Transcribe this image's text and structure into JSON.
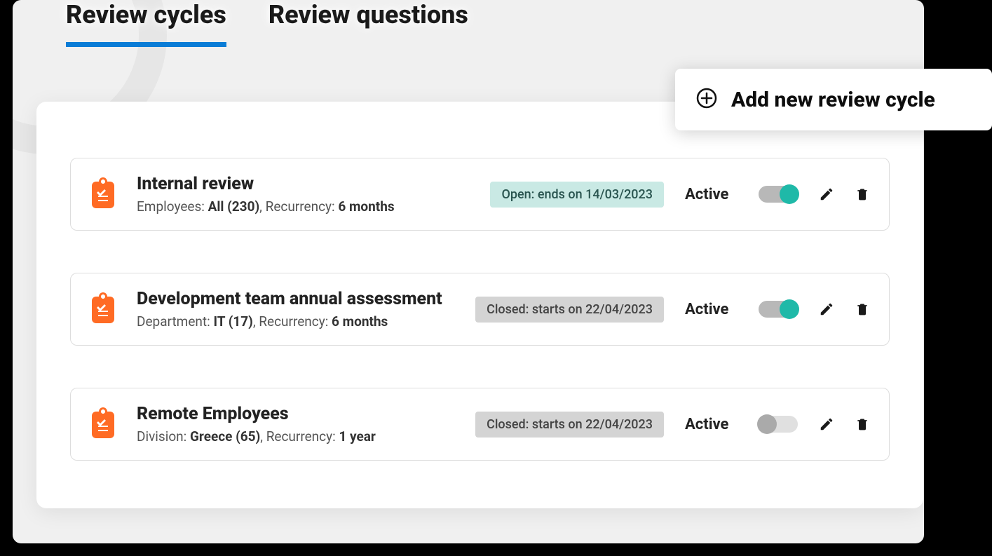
{
  "tabs": {
    "active": "Review cycles",
    "inactive": "Review questions"
  },
  "addButton": {
    "label": "Add new review cycle"
  },
  "cycles": [
    {
      "title": "Internal review",
      "meta1Label": "Employees: ",
      "meta1Value": "All (230)",
      "metaSep": ", ",
      "meta2Label": "Recurrency: ",
      "meta2Value": "6 months",
      "statusText": "Open: ends on 14/03/2023",
      "statusType": "open",
      "activeLabel": "Active",
      "toggleOn": true
    },
    {
      "title": "Development team  annual assessment",
      "meta1Label": "Department: ",
      "meta1Value": "IT (17)",
      "metaSep": ", ",
      "meta2Label": "Recurrency: ",
      "meta2Value": "6 months",
      "statusText": "Closed: starts on 22/04/2023",
      "statusType": "closed",
      "activeLabel": "Active",
      "toggleOn": true
    },
    {
      "title": "Remote Employees",
      "meta1Label": "Division: ",
      "meta1Value": "Greece (65)",
      "metaSep": ", ",
      "meta2Label": "Recurrency: ",
      "meta2Value": "1 year",
      "statusText": "Closed: starts on 22/04/2023",
      "statusType": "closed",
      "activeLabel": "Active",
      "toggleOn": false
    }
  ]
}
